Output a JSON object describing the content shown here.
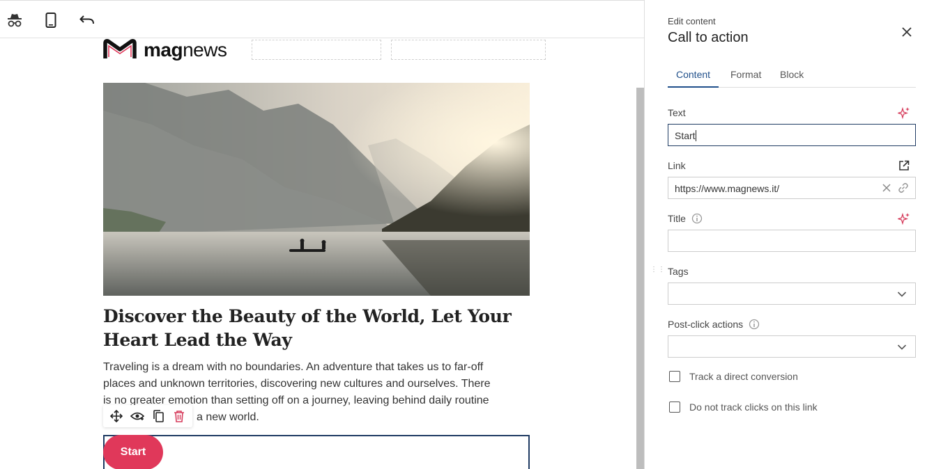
{
  "toolbar": {
    "icons": [
      "incognito-icon",
      "mobile-preview-icon",
      "undo-icon"
    ]
  },
  "email": {
    "logo": {
      "text_bold": "mag",
      "text_regular": "news"
    },
    "headline": "Discover the Beauty of the World, Let Your Heart Lead the Way",
    "body_line_1": "Traveling is a dream with no boundaries. An adventure that takes us to far-off",
    "body_line_2": "places and unknown territories, discovering new cultures and ourselves. There",
    "body_line_3": "is no greater emotion than setting off on a journey, leaving behind daily routine",
    "body_line_4_visible": "a new world.",
    "cta_label": "Start",
    "block_tools": [
      "move-icon",
      "visibility-icon",
      "duplicate-icon",
      "delete-icon"
    ]
  },
  "panel": {
    "subtitle": "Edit content",
    "title": "Call to action",
    "tabs": [
      {
        "label": "Content",
        "active": true
      },
      {
        "label": "Format",
        "active": false
      },
      {
        "label": "Block",
        "active": false
      }
    ],
    "fields": {
      "text": {
        "label": "Text",
        "value": "Start"
      },
      "link": {
        "label": "Link",
        "value": "https://www.magnews.it/"
      },
      "title": {
        "label": "Title",
        "value": ""
      },
      "tags": {
        "label": "Tags",
        "value": ""
      },
      "post_click": {
        "label": "Post-click actions",
        "value": ""
      }
    },
    "checkboxes": [
      {
        "label": "Track a direct conversion",
        "checked": false
      },
      {
        "label": "Do not track clicks on this link",
        "checked": false
      }
    ]
  },
  "colors": {
    "accent": "#1f4f8a",
    "cta": "#e0385a",
    "ai_sparkle": "#d63a5a"
  }
}
